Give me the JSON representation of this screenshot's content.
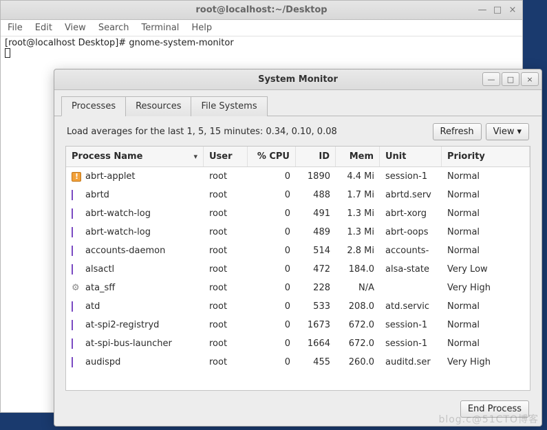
{
  "terminal": {
    "title": "root@localhost:~/Desktop",
    "menu": [
      "File",
      "Edit",
      "View",
      "Search",
      "Terminal",
      "Help"
    ],
    "line1": "[root@localhost Desktop]# gnome-system-monitor"
  },
  "sysmon": {
    "title": "System Monitor",
    "tabs": [
      "Processes",
      "Resources",
      "File Systems"
    ],
    "active_tab": 0,
    "load_text": "Load averages for the last 1, 5, 15 minutes: 0.34, 0.10, 0.08",
    "buttons": {
      "refresh": "Refresh",
      "view": "View",
      "end": "End Process"
    },
    "columns": [
      "Process Name",
      "User",
      "% CPU",
      "ID",
      "Mem",
      "Unit",
      "Priority"
    ],
    "processes": [
      {
        "icon": "warn",
        "name": "abrt-applet",
        "user": "root",
        "cpu": "0",
        "id": "1890",
        "mem": "4.4 Mi",
        "unit": "session-1",
        "priority": "Normal"
      },
      {
        "icon": "diamond",
        "name": "abrtd",
        "user": "root",
        "cpu": "0",
        "id": "488",
        "mem": "1.7 Mi",
        "unit": "abrtd.serv",
        "priority": "Normal"
      },
      {
        "icon": "diamond",
        "name": "abrt-watch-log",
        "user": "root",
        "cpu": "0",
        "id": "491",
        "mem": "1.3 Mi",
        "unit": "abrt-xorg",
        "priority": "Normal"
      },
      {
        "icon": "diamond",
        "name": "abrt-watch-log",
        "user": "root",
        "cpu": "0",
        "id": "489",
        "mem": "1.3 Mi",
        "unit": "abrt-oops",
        "priority": "Normal"
      },
      {
        "icon": "diamond",
        "name": "accounts-daemon",
        "user": "root",
        "cpu": "0",
        "id": "514",
        "mem": "2.8 Mi",
        "unit": "accounts-",
        "priority": "Normal"
      },
      {
        "icon": "diamond",
        "name": "alsactl",
        "user": "root",
        "cpu": "0",
        "id": "472",
        "mem": "184.0",
        "unit": "alsa-state",
        "priority": "Very Low"
      },
      {
        "icon": "gear",
        "name": "ata_sff",
        "user": "root",
        "cpu": "0",
        "id": "228",
        "mem": "N/A",
        "unit": "",
        "priority": "Very High"
      },
      {
        "icon": "diamond",
        "name": "atd",
        "user": "root",
        "cpu": "0",
        "id": "533",
        "mem": "208.0",
        "unit": "atd.servic",
        "priority": "Normal"
      },
      {
        "icon": "diamond",
        "name": "at-spi2-registryd",
        "user": "root",
        "cpu": "0",
        "id": "1673",
        "mem": "672.0",
        "unit": "session-1",
        "priority": "Normal"
      },
      {
        "icon": "diamond",
        "name": "at-spi-bus-launcher",
        "user": "root",
        "cpu": "0",
        "id": "1664",
        "mem": "672.0",
        "unit": "session-1",
        "priority": "Normal"
      },
      {
        "icon": "diamond",
        "name": "audispd",
        "user": "root",
        "cpu": "0",
        "id": "455",
        "mem": "260.0",
        "unit": "auditd.ser",
        "priority": "Very High"
      }
    ]
  },
  "watermark": "blog.c@51CTO博客"
}
